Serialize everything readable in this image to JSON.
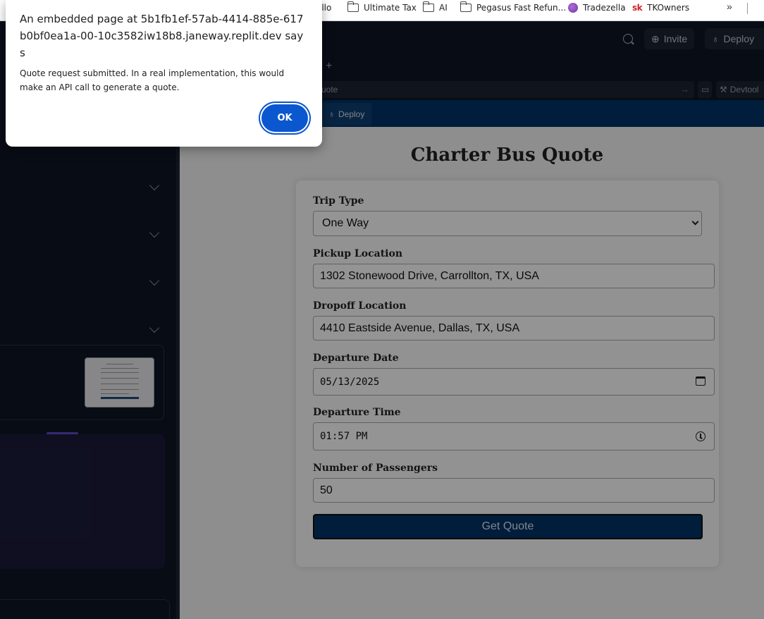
{
  "bookmarks": [
    {
      "label": "ollo",
      "icon": "none"
    },
    {
      "label": "Ultimate Tax",
      "icon": "folder-icon"
    },
    {
      "label": "AI",
      "icon": "folder-icon"
    },
    {
      "label": "Pegasus Fast Refun...",
      "icon": "folder-icon"
    },
    {
      "label": "Tradezella",
      "icon": "tradezella-icon"
    },
    {
      "label": "TKOwners",
      "icon": "sk-icon"
    }
  ],
  "bookmarks_more": "»",
  "topbar": {
    "invite_label": "Invite",
    "deploy_label": "Deploy"
  },
  "webview": {
    "new_tab": "+",
    "url_text": "uote",
    "url_go": "→",
    "devtools_label": "Devtool",
    "deploy_label": "Deploy"
  },
  "app": {
    "title": "Charter Bus Quote",
    "fields": {
      "trip_type_label": "Trip Type",
      "trip_type_value": "One Way",
      "pickup_label": "Pickup Location",
      "pickup_value": "1302 Stonewood Drive, Carrollton, TX, USA",
      "dropoff_label": "Dropoff Location",
      "dropoff_value": "4410 Eastside Avenue, Dallas, TX, USA",
      "date_label": "Departure Date",
      "date_value": "05/13/2025",
      "time_label": "Departure Time",
      "time_value": "01:57 PM",
      "passengers_label": "Number of Passengers",
      "passengers_value": "50"
    },
    "submit_label": "Get Quote"
  },
  "dialog": {
    "title": "An embedded page at 5b1fb1ef-57ab-4414-885e-617b0bf0ea1a-00-10c3582iw18b8.janeway.replit.dev says",
    "message": "Quote request submitted. In a real implementation, this would make an API call to generate a quote.",
    "ok_label": "OK"
  },
  "colors": {
    "accent": "#003366",
    "dialog_button": "#0b57d0",
    "ide_background": "#0e1525"
  }
}
